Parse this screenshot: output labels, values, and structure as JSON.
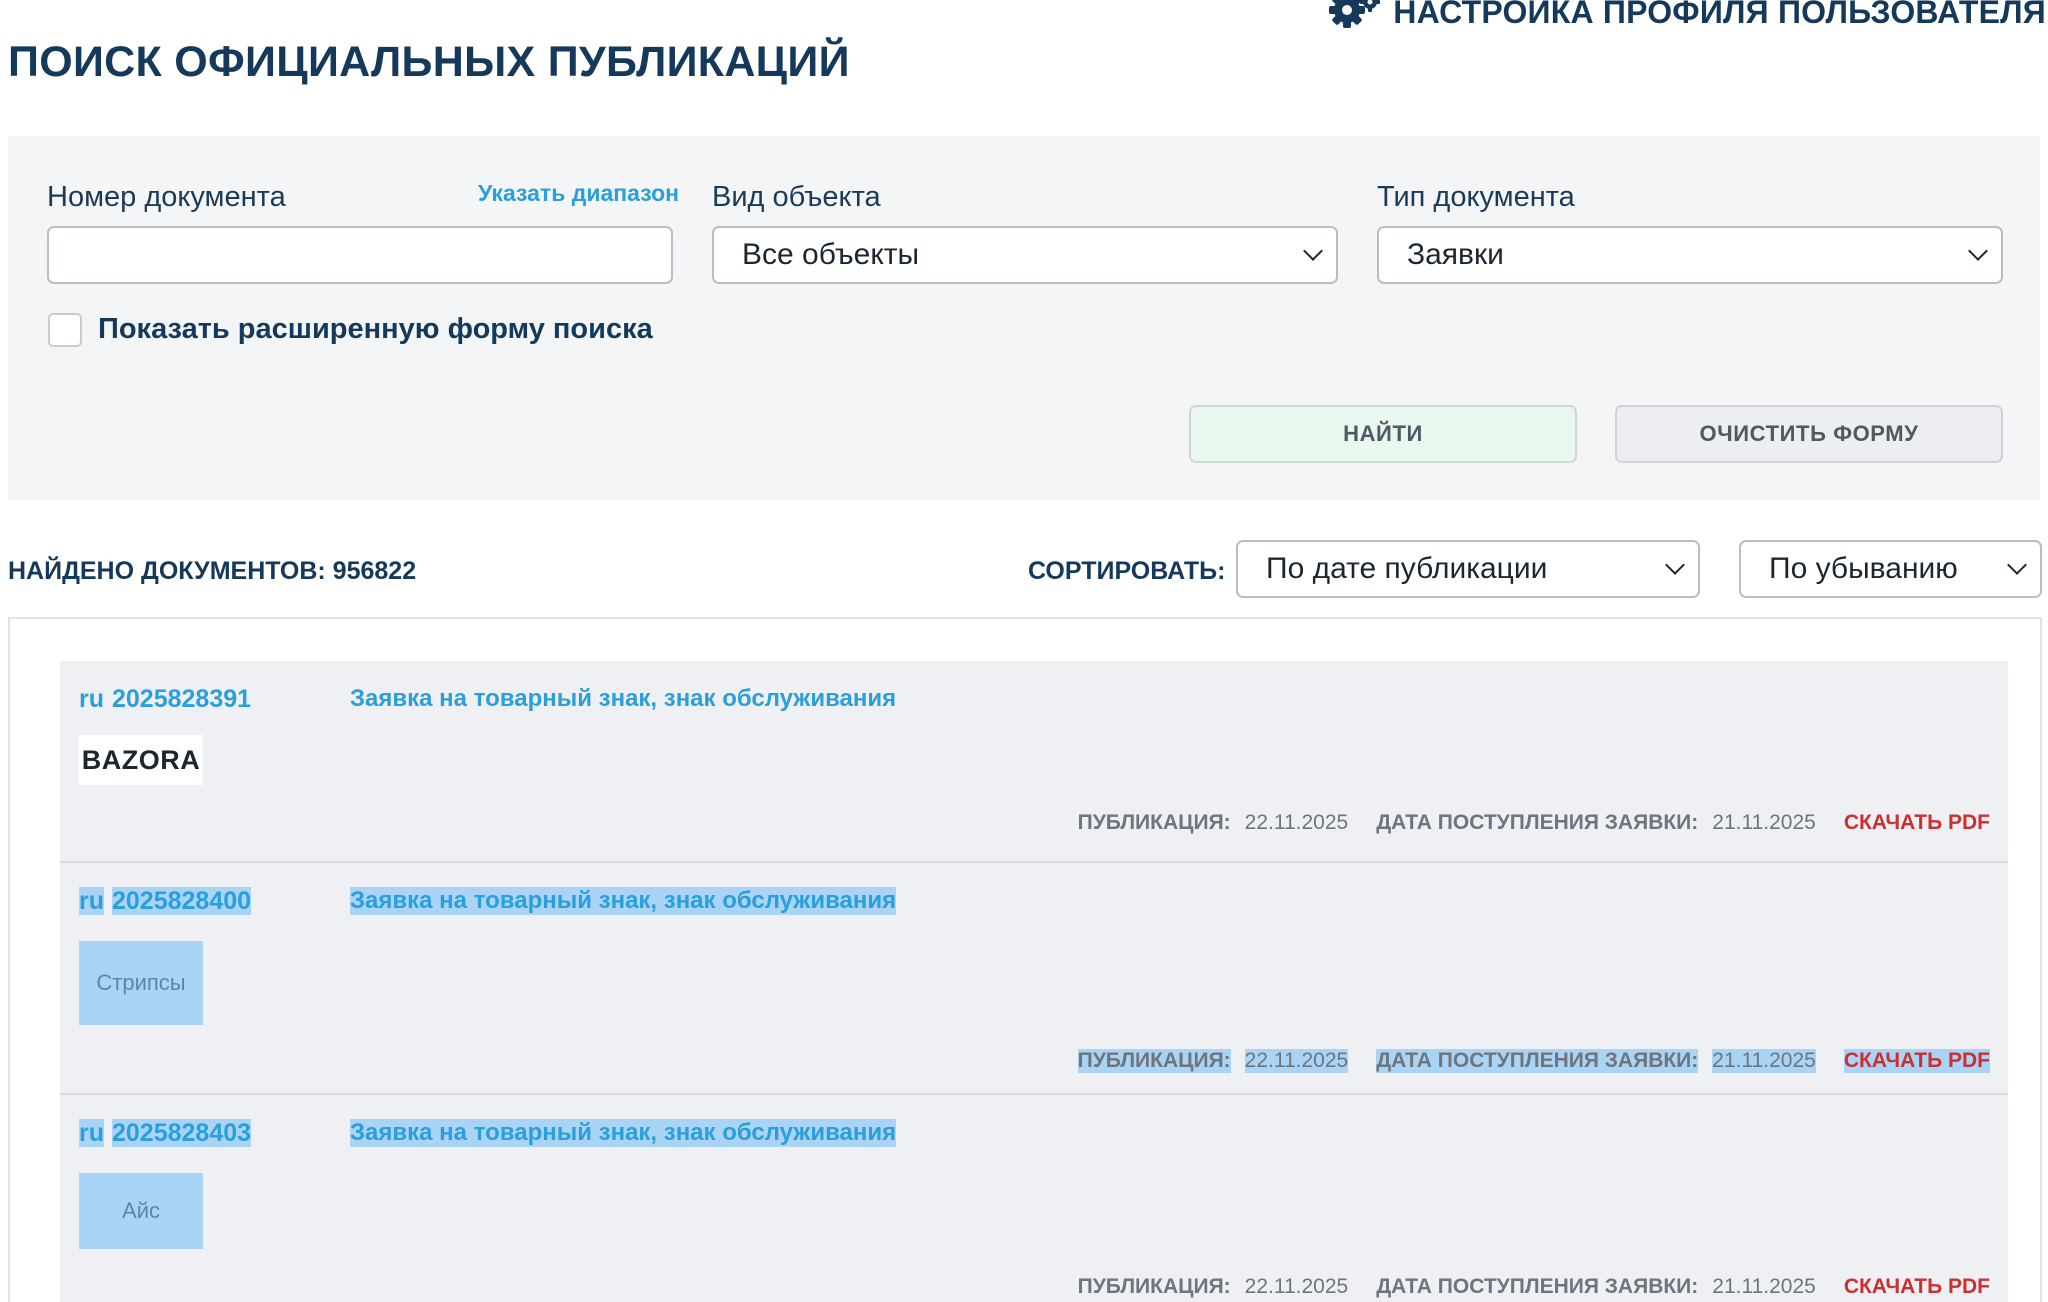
{
  "header": {
    "profile_link": "НАСТРОЙКА ПРОФИЛЯ ПОЛЬЗОВАТЕЛЯ",
    "page_title": "ПОИСК ОФИЦИАЛЬНЫХ ПУБЛИКАЦИЙ"
  },
  "search_form": {
    "doc_number_label": "Номер документа",
    "doc_number_value": "",
    "range_link": "Указать диапазон",
    "object_type_label": "Вид объекта",
    "object_type_value": "Все объекты",
    "doc_type_label": "Тип документа",
    "doc_type_value": "Заявки",
    "extended_form_label": "Показать расширенную форму поиска",
    "find_button": "НАЙТИ",
    "clear_button": "ОЧИСТИТЬ ФОРМУ"
  },
  "results_bar": {
    "found": "НАЙДЕНО ДОКУМЕНТОВ: 956822",
    "sort_label": "СОРТИРОВАТЬ:",
    "sort_field": "По дате публикации",
    "sort_order": "По убыванию"
  },
  "results": [
    {
      "country": "ru",
      "number": "2025828391",
      "type": "Заявка на товарный знак, знак обслуживания",
      "mark": "BAZORA",
      "publication_label": "ПУБЛИКАЦИЯ:",
      "publication_date": "22.11.2025",
      "filing_label": "ДАТА ПОСТУПЛЕНИЯ ЗАЯВКИ:",
      "filing_date": "21.11.2025",
      "download": "СКАЧАТЬ PDF"
    },
    {
      "country": "ru",
      "number": "2025828400",
      "type": "Заявка на товарный знак, знак обслуживания",
      "mark": "Стрипсы",
      "publication_label": "ПУБЛИКАЦИЯ:",
      "publication_date": "22.11.2025",
      "filing_label": "ДАТА ПОСТУПЛЕНИЯ ЗАЯВКИ:",
      "filing_date": "21.11.2025",
      "download": "СКАЧАТЬ PDF"
    },
    {
      "country": "ru",
      "number": "2025828403",
      "type": "Заявка на товарный знак, знак обслуживания",
      "mark": "Айс",
      "publication_label": "ПУБЛИКАЦИЯ:",
      "publication_date": "22.11.2025",
      "filing_label": "ДАТА ПОСТУПЛЕНИЯ ЗАЯВКИ:",
      "filing_date": "21.11.2025",
      "download": "СКАЧАТЬ PDF"
    }
  ],
  "colors": {
    "heading": "#15395a",
    "link": "#2a9fdb",
    "pdf": "#cc2f30",
    "selection": "#a9d4f5",
    "panel": "#f4f5f7"
  }
}
